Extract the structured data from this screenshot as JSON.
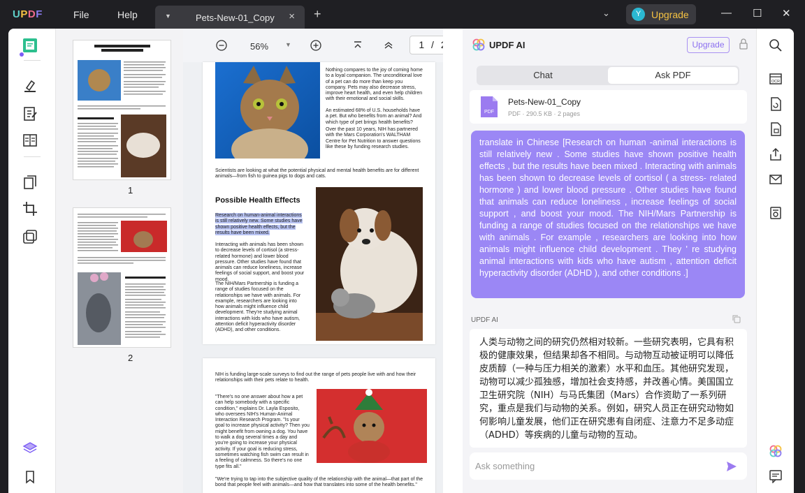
{
  "app": {
    "menu": {
      "file": "File",
      "help": "Help"
    },
    "tab": {
      "title": "Pets-New-01_Copy"
    },
    "upgrade": {
      "avatar_letter": "Y",
      "label": "Upgrade"
    }
  },
  "viewer": {
    "zoom": "56%",
    "current_page": "1",
    "page_sep": "/",
    "total_pages": "2"
  },
  "thumbnails": [
    {
      "number": "1"
    },
    {
      "number": "2"
    }
  ],
  "document": {
    "page1": {
      "intro_text": "Nothing compares to the joy of coming home to a loyal companion. The unconditional love of a pet can do more than keep you company. Pets may also decrease stress, improve heart health, and even help children with their emotional and social skills.",
      "stat_text": "An estimated 68% of U.S. households have a pet. But who benefits from an animal? And which type of pet brings health benefits?",
      "nih_text": "Over the past 10 years, NIH has partnered with the Mars Corporation's WALTHAM Centre for Pet Nutrition to answer questions like these by funding research studies.",
      "scientists_text": "Scientists are looking at what the potential physical and mental health benefits are for different animals—from fish to guinea pigs to dogs and cats.",
      "heading": "Possible Health Effects",
      "highlighted_text": "Research on human-animal interactions is still relatively new. Some studies have shown positive health effects, but the results have been mixed.",
      "body_text_1": "Interacting with animals has been shown to decrease levels of cortisol (a stress-related hormone) and lower blood pressure. Other studies have found that animals can reduce loneliness, increase feelings of social support, and boost your mood.",
      "body_text_2": "The NIH/Mars Partnership is funding a range of studies focused on the relationships we have with animals. For example, researchers are looking into how animals might influence child development. They're studying animal interactions with kids who have autism, attention deficit hyperactivity disorder (ADHD), and other conditions."
    },
    "page2": {
      "intro_text": "NIH is funding large-scale surveys to find out the range of pets people live with and how their relationships with their pets relate to health.",
      "quote_text": "\"There's no one answer about how a pet can help somebody with a specific condition,\" explains Dr. Layla Esposito, who oversees NIH's Human-Animal Interaction Research Program. \"Is your goal to increase physical activity? Then you might benefit from owning a dog. You have to walk a dog several times a day and you're going to increase your physical activity. If your goal is reducing stress, sometimes watching fish swim can result in a feeling of calmness. So there's no one type fits all.\"",
      "bottom_text": "\"We're trying to tap into the subjective quality of the relationship with the animal—that part of the bond that people feel with animals—and how that translates into some of the health benefits.\""
    }
  },
  "ai_panel": {
    "title": "UPDF AI",
    "upgrade_label": "Upgrade",
    "tabs": {
      "chat": "Chat",
      "ask_pdf": "Ask PDF"
    },
    "file": {
      "name": "Pets-New-01_Copy",
      "meta": "PDF · 290.5 KB · 2 pages",
      "icon_text": "PDF"
    },
    "user_message": "translate in Chinese [Research on human -animal interactions is still relatively new . Some studies have shown positive health effects , but the results have been mixed . Interacting with animals has been shown to decrease levels of cortisol ( a stress- related hormone ) and lower blood pressure . Other studies have found that animals can reduce loneliness , increase feelings of social support , and boost your mood. The NIH/Mars Partnership is funding a range of studies focused on the relationships we have with animals . For example , researchers are looking into how animals might influence child development . They ' re studying animal interactions with kids who have autism , attention deficit hyperactivity disorder (ADHD ), and other conditions .]",
    "reply_label": "UPDF AI",
    "reply_text": "人类与动物之间的研究仍然相对较新。一些研究表明，它具有积极的健康效果，但结果却各不相同。与动物互动被证明可以降低皮质醇（一种与压力相关的激素）水平和血压。其他研究发现，动物可以减少孤独感，增加社会支持感，并改善心情。美国国立卫生研究院（NIH）与马氏集团（Mars）合作资助了一系列研究，重点是我们与动物的关系。例如，研究人员正在研究动物如何影响儿童发展，他们正在研究患有自闭症、注意力不足多动症（ADHD）等疾病的儿童与动物的互动。",
    "input_placeholder": "Ask something"
  },
  "colors": {
    "accent": "#9b87f5",
    "brand_purple": "#7b5cf5",
    "upgrade_gold": "#f5c242"
  }
}
